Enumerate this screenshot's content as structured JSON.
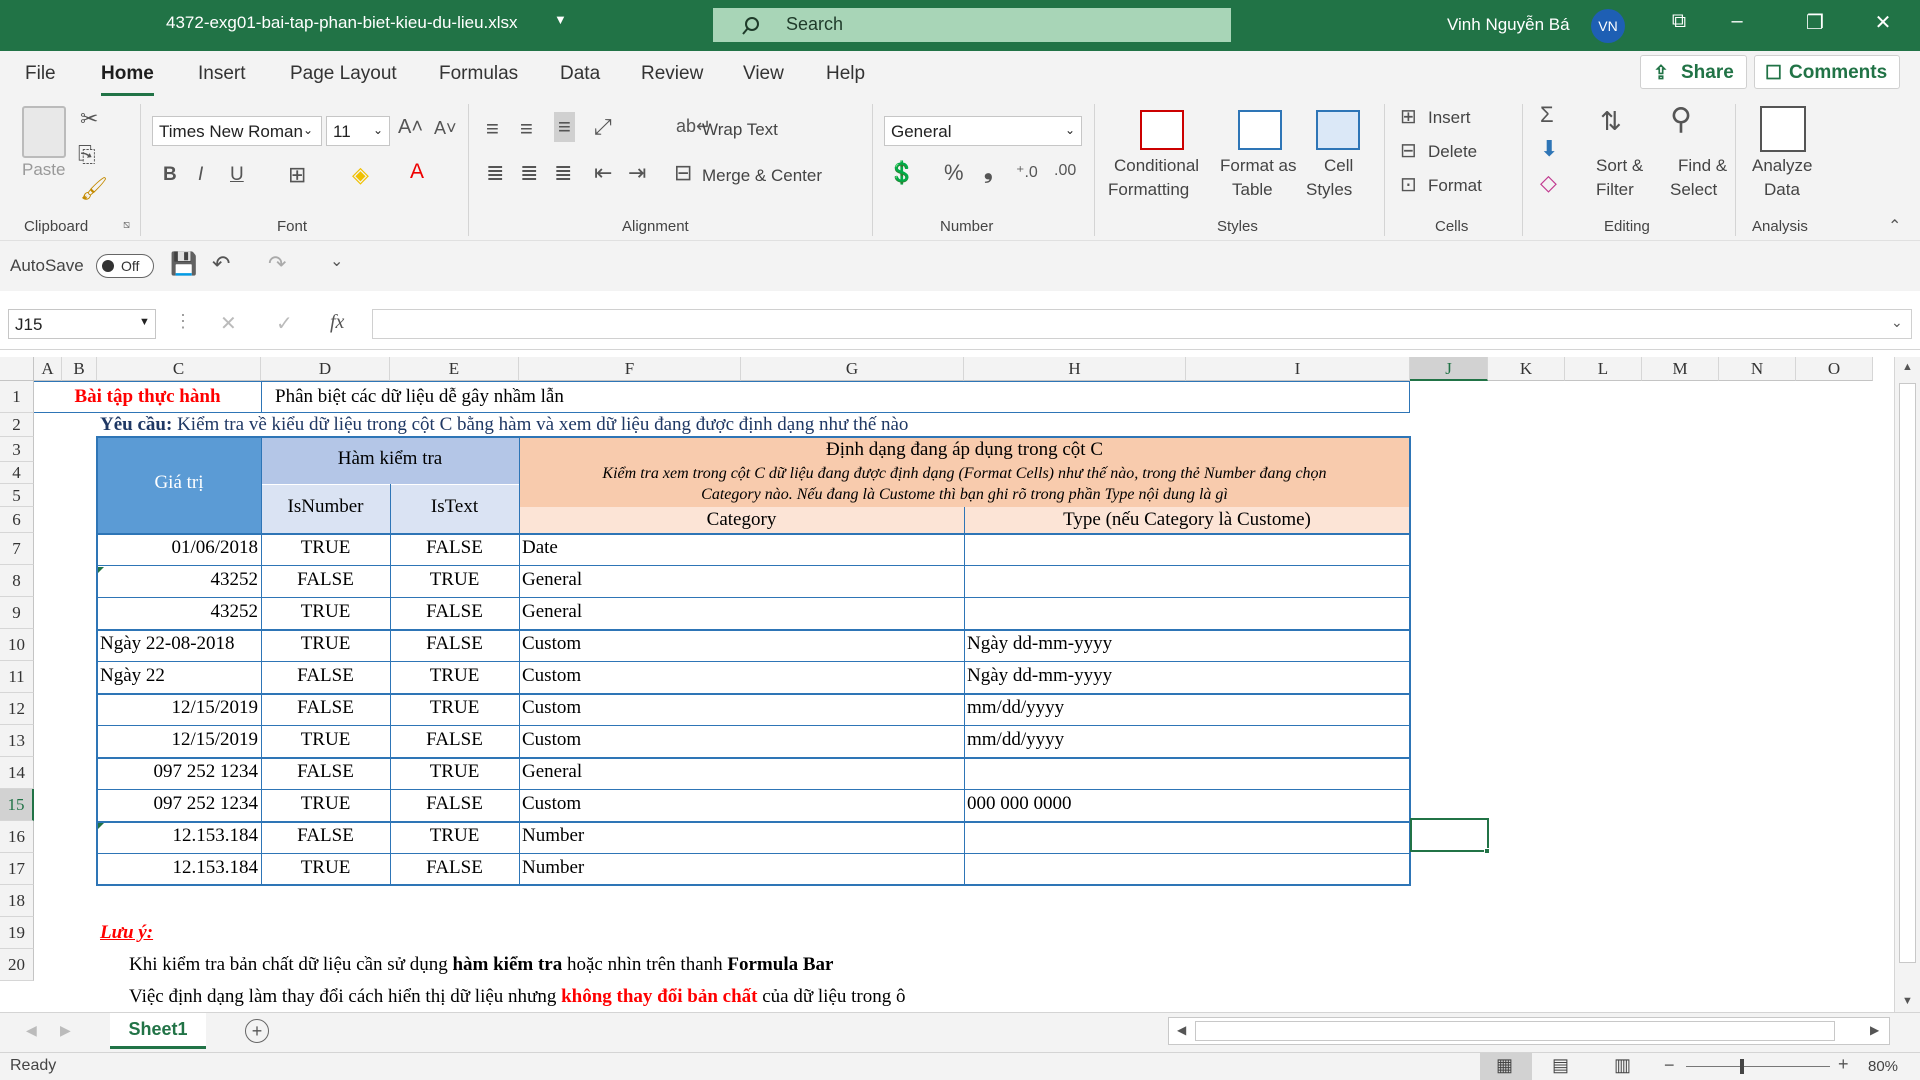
{
  "titlebar": {
    "filename": "4372-exg01-bai-tap-phan-biet-kieu-du-lieu.xlsx",
    "search_placeholder": "Search",
    "user_name": "Vinh Nguyễn Bá",
    "user_initials": "VN"
  },
  "tabs": [
    "File",
    "Home",
    "Insert",
    "Page Layout",
    "Formulas",
    "Data",
    "Review",
    "View",
    "Help"
  ],
  "active_tab": "Home",
  "share_label": "Share",
  "comments_label": "Comments",
  "ribbon": {
    "clipboard": {
      "paste": "Paste",
      "label": "Clipboard"
    },
    "font": {
      "name": "Times New Roman",
      "size": "11",
      "label": "Font"
    },
    "alignment": {
      "wrap_text": "Wrap Text",
      "merge_center": "Merge & Center",
      "label": "Alignment"
    },
    "number": {
      "format": "General",
      "label": "Number"
    },
    "styles": {
      "conditional_1": "Conditional",
      "conditional_2": "Formatting",
      "format_as_1": "Format as",
      "format_as_2": "Table",
      "cell_1": "Cell",
      "cell_2": "Styles",
      "label": "Styles"
    },
    "cells": {
      "insert": "Insert",
      "delete": "Delete",
      "format": "Format",
      "label": "Cells"
    },
    "editing": {
      "sort_1": "Sort &",
      "sort_2": "Filter",
      "find_1": "Find &",
      "find_2": "Select",
      "label": "Editing"
    },
    "analysis": {
      "analyze_1": "Analyze",
      "analyze_2": "Data",
      "label": "Analysis"
    }
  },
  "qat": {
    "autosave": "AutoSave",
    "toggle": "Off"
  },
  "formula_bar": {
    "name_box": "J15",
    "fx": "fx",
    "value": ""
  },
  "columns": [
    "A",
    "B",
    "C",
    "D",
    "E",
    "F",
    "G",
    "H",
    "I",
    "J",
    "K",
    "L",
    "M",
    "N",
    "O"
  ],
  "rows": [
    "1",
    "2",
    "3",
    "4",
    "5",
    "6",
    "7",
    "8",
    "9",
    "10",
    "11",
    "12",
    "13",
    "14",
    "15",
    "16",
    "17",
    "18",
    "19",
    "20"
  ],
  "sheet": {
    "title_label": "Bài tập thực hành",
    "title_text": "Phân biệt các dữ liệu dễ gây nhầm lẫn",
    "req_bold": "Yêu cầu:",
    "req_text": " Kiểm tra về kiểu dữ liệu trong cột C bằng hàm và xem dữ liệu đang được định dạng như thế nào",
    "hdr_value": "Giá trị",
    "hdr_func": "Hàm kiểm tra",
    "hdr_isnumber": "IsNumber",
    "hdr_istext": "IsText",
    "hdr_format": "Định dạng đang áp dụng trong cột C",
    "hdr_format_note1": "Kiểm tra xem trong cột C dữ liệu đang được định dạng (Format Cells) như thế nào, trong thẻ Number đang chọn",
    "hdr_format_note2": "Category nào. Nếu đang là Custome thì bạn ghi rõ trong phần Type nội dung là gì",
    "hdr_category": "Category",
    "hdr_type": "Type (nếu Category là Custome)",
    "data_rows": [
      {
        "value": "01/06/2018",
        "align": "right",
        "isnumber": "TRUE",
        "istext": "FALSE",
        "category": "Date",
        "type": ""
      },
      {
        "value": "43252",
        "align": "right",
        "isnumber": "FALSE",
        "istext": "TRUE",
        "category": "General",
        "type": ""
      },
      {
        "value": "43252",
        "align": "right",
        "isnumber": "TRUE",
        "istext": "FALSE",
        "category": "General",
        "type": ""
      },
      {
        "value": "Ngày 22-08-2018",
        "align": "left",
        "isnumber": "TRUE",
        "istext": "FALSE",
        "category": "Custom",
        "type": "Ngày dd-mm-yyyy"
      },
      {
        "value": "Ngày 22",
        "align": "left",
        "isnumber": "FALSE",
        "istext": "TRUE",
        "category": "Custom",
        "type": "Ngày dd-mm-yyyy"
      },
      {
        "value": "12/15/2019",
        "align": "right",
        "isnumber": "FALSE",
        "istext": "TRUE",
        "category": "Custom",
        "type": "mm/dd/yyyy"
      },
      {
        "value": "12/15/2019",
        "align": "right",
        "isnumber": "TRUE",
        "istext": "FALSE",
        "category": "Custom",
        "type": "mm/dd/yyyy"
      },
      {
        "value": "097 252 1234",
        "align": "right",
        "isnumber": "FALSE",
        "istext": "TRUE",
        "category": "General",
        "type": ""
      },
      {
        "value": "097 252 1234",
        "align": "right",
        "isnumber": "TRUE",
        "istext": "FALSE",
        "category": "Custom",
        "type": "000 000 0000"
      },
      {
        "value": "12.153.184",
        "align": "right",
        "isnumber": "FALSE",
        "istext": "TRUE",
        "category": "Number",
        "type": ""
      },
      {
        "value": "12.153.184",
        "align": "right",
        "isnumber": "TRUE",
        "istext": "FALSE",
        "category": "Number",
        "type": ""
      }
    ],
    "note_label": "Lưu ý:",
    "note1_a": "Khi kiểm tra bản chất dữ liệu cần sử dụng ",
    "note1_b": "hàm kiểm tra",
    "note1_c": " hoặc nhìn trên thanh ",
    "note1_d": "Formula Bar",
    "note2_a": "Việc định dạng làm thay đổi cách hiển thị dữ liệu nhưng ",
    "note2_b": "không thay đổi bản chất",
    "note2_c": " của dữ liệu trong ô"
  },
  "sheet_tab": "Sheet1",
  "status": {
    "ready": "Ready",
    "zoom": "80%"
  },
  "colors": {
    "excel_green": "#217346",
    "header_blue": "#5b9bd5",
    "header_light_blue": "#b4c6e7",
    "header_orange": "#f8cbad",
    "header_light_orange": "#fce4d6",
    "red": "#ff0000",
    "border_blue": "#2e75b6"
  }
}
